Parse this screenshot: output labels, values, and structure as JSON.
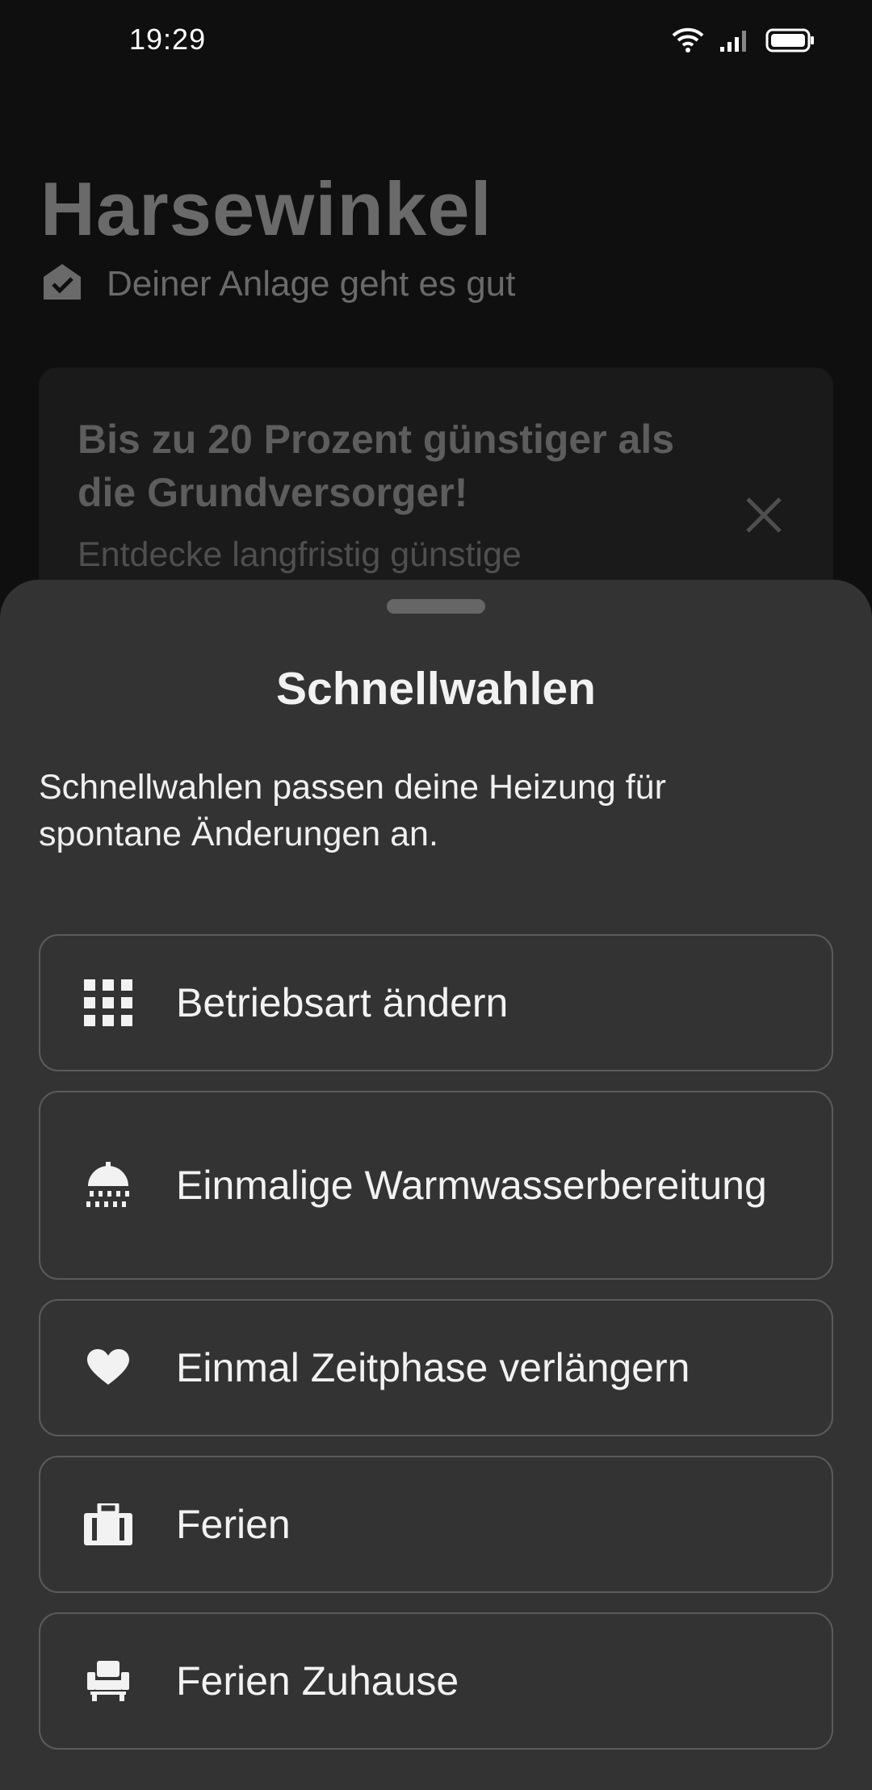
{
  "status_bar": {
    "time": "19:29",
    "icons": [
      "wifi-icon",
      "signal-icon",
      "battery-icon"
    ]
  },
  "background": {
    "title": "Harsewinkel",
    "health_status": "Deiner Anlage geht es gut",
    "health_icon": "house-check-icon",
    "promo": {
      "title": "Bis zu 20 Prozent günstiger als die Grundversorger!",
      "subtitle": "Entdecke langfristig günstige",
      "close_icon": "close-icon"
    }
  },
  "sheet": {
    "title": "Schnellwahlen",
    "description": "Schnellwahlen passen deine Heizung für spontane Änderungen an.",
    "options": [
      {
        "label": "Betriebsart ändern",
        "icon": "grid-icon"
      },
      {
        "label": "Einmalige Warmwasserbereitung",
        "icon": "shower-icon"
      },
      {
        "label": "Einmal Zeitphase verlängern",
        "icon": "heart-icon"
      },
      {
        "label": "Ferien",
        "icon": "suitcase-icon"
      },
      {
        "label": "Ferien Zuhause",
        "icon": "armchair-icon"
      }
    ]
  },
  "colors": {
    "sheet_bg": "#333333",
    "page_bg": "#0f0f0f",
    "option_border": "#5b5b5b",
    "text_primary": "#f2f2f2",
    "text_dimmed": "#6a6a6a"
  }
}
